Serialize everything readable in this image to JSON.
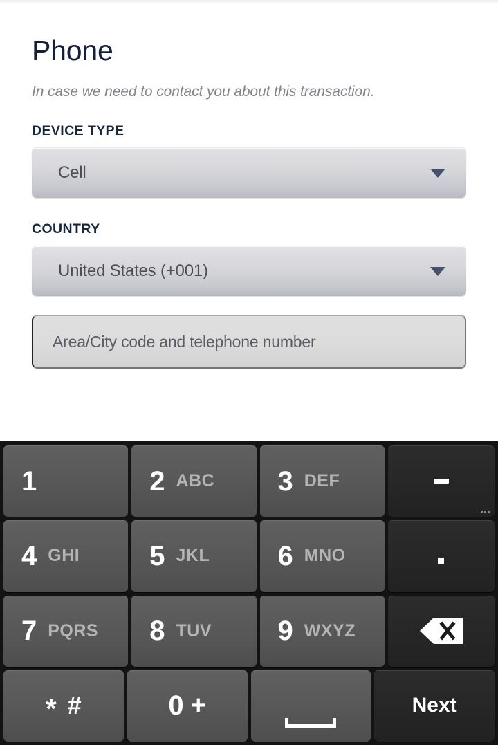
{
  "page": {
    "title": "Phone",
    "subtitle": "In case we need to contact you about this transaction."
  },
  "form": {
    "device_type": {
      "label": "DEVICE TYPE",
      "value": "Cell",
      "caret_icon": "chevron-down-icon"
    },
    "country": {
      "label": "COUNTRY",
      "value": "United States (+001)",
      "caret_icon": "chevron-down-icon"
    },
    "phone_number": {
      "value": "",
      "placeholder": "Area/City code and telephone number"
    }
  },
  "keyboard": {
    "type": "numeric-phone-keypad",
    "rows": [
      [
        {
          "digit": "1",
          "letters": ""
        },
        {
          "digit": "2",
          "letters": "ABC"
        },
        {
          "digit": "3",
          "letters": "DEF"
        },
        {
          "symbol": "-",
          "icon": "dash-key",
          "more_dots": "..."
        }
      ],
      [
        {
          "digit": "4",
          "letters": "GHI"
        },
        {
          "digit": "5",
          "letters": "JKL"
        },
        {
          "digit": "6",
          "letters": "MNO"
        },
        {
          "symbol": ".",
          "icon": "period-key"
        }
      ],
      [
        {
          "digit": "7",
          "letters": "PQRS"
        },
        {
          "digit": "8",
          "letters": "TUV"
        },
        {
          "digit": "9",
          "letters": "WXYZ"
        },
        {
          "symbol": "",
          "icon": "backspace-icon"
        }
      ],
      [
        {
          "symbol": "* #",
          "star": "*",
          "hash": "#"
        },
        {
          "digit": "0",
          "plus": "+"
        },
        {
          "symbol": "",
          "icon": "space-bar-icon"
        },
        {
          "label": "Next",
          "icon": "next-key"
        }
      ]
    ]
  },
  "colors": {
    "page_background": "#ffffff",
    "title_navy": "#12203d",
    "subtitle_gray": "#80838b",
    "label_navy": "#17273f",
    "select_gradient_top": "#e1e1e4",
    "select_gradient_bottom": "#b7b8c0",
    "input_gradient_top": "#dfdfdf",
    "input_gradient_bottom": "#d4d4d4",
    "keyboard_background": "#131313",
    "key_gray": "#585858",
    "key_dark": "#262626",
    "key_text": "#ffffff",
    "key_letters": "#b4b4b4"
  }
}
